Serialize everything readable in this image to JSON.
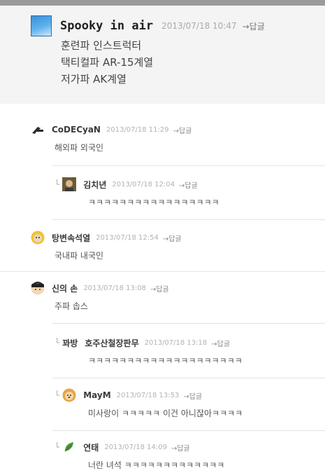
{
  "post": {
    "author": "Spooky in air",
    "date": "2013/07/18 10:47",
    "reply_label": "→답글",
    "lines": [
      "훈련파 인스트럭터",
      "택티컬파 AR-15계열",
      "저가파 AK계열"
    ]
  },
  "comments": [
    {
      "author": "CoDECyaN",
      "date": "2013/07/18 11:29",
      "reply_label": "→답글",
      "text": "해외파 외국인",
      "level": 0
    },
    {
      "author": "김치년",
      "date": "2013/07/18 12:04",
      "reply_label": "→답글",
      "text": "ㅋㅋㅋㅋㅋㅋㅋㅋㅋㅋㅋㅋㅋㅋㅋㅋㅋ",
      "level": 1
    },
    {
      "author": "탕변속석열",
      "date": "2013/07/18 12:54",
      "reply_label": "→답글",
      "text": "국내파 내국인",
      "level": 0
    },
    {
      "author": "신의 손",
      "date": "2013/07/18 13:08",
      "reply_label": "→답글",
      "text": "주파 솝스",
      "level": 0
    },
    {
      "author": "호주산철장판무",
      "date": "2013/07/18 13:18",
      "reply_label": "→답글",
      "text": "ㅋㅋㅋㅋㅋㅋㅋㅋㅋㅋㅋㅋㅋㅋㅋㅋㅋㅋㅋㅋ",
      "level": 1,
      "prefix": "꽈방"
    },
    {
      "author": "MayM",
      "date": "2013/07/18 13:53",
      "reply_label": "→답글",
      "text": "미사랑이 ㅋㅋㅋㅋㅋ 이건 아니잖아ㅋㅋㅋㅋ",
      "level": 1
    },
    {
      "author": "연태",
      "date": "2013/07/18 14:09",
      "reply_label": "→답글",
      "text": "너란 녀석 ㅋㅋㅋㅋㅋㅋㅋㅋㅋㅋㅋㅋㅋ",
      "level": 1
    }
  ],
  "colors": {
    "accent": "#3b8fd6",
    "op_bg": "#f4f4f4",
    "divider": "#e4e4e4"
  }
}
